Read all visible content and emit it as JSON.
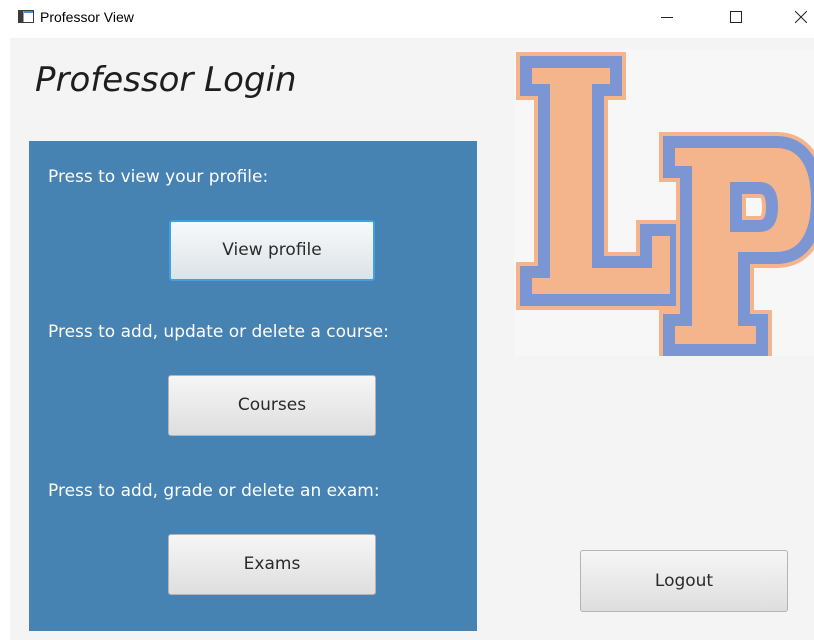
{
  "window": {
    "title": "Professor View"
  },
  "page": {
    "title": "Professor Login"
  },
  "panel": {
    "profile_prompt": "Press to view your profile:",
    "profile_button": "View profile",
    "courses_prompt": "Press to add, update or delete a course:",
    "courses_button": "Courses",
    "exams_prompt": "Press to add, grade or delete an exam:",
    "exams_button": "Exams"
  },
  "logout_button": "Logout",
  "logo": {
    "letters": "LP",
    "colors": {
      "fill": "#f4b48c",
      "outline": "#7b96d2",
      "outer_edge": "#f4b48c"
    }
  },
  "colors": {
    "panel_background": "#4682b2",
    "focus_ring": "#39a3e6",
    "window_background": "#f4f4f4"
  },
  "icons": {
    "app": "app-window-icon",
    "minimize": "minimize-icon",
    "maximize": "maximize-icon",
    "close": "close-icon"
  }
}
